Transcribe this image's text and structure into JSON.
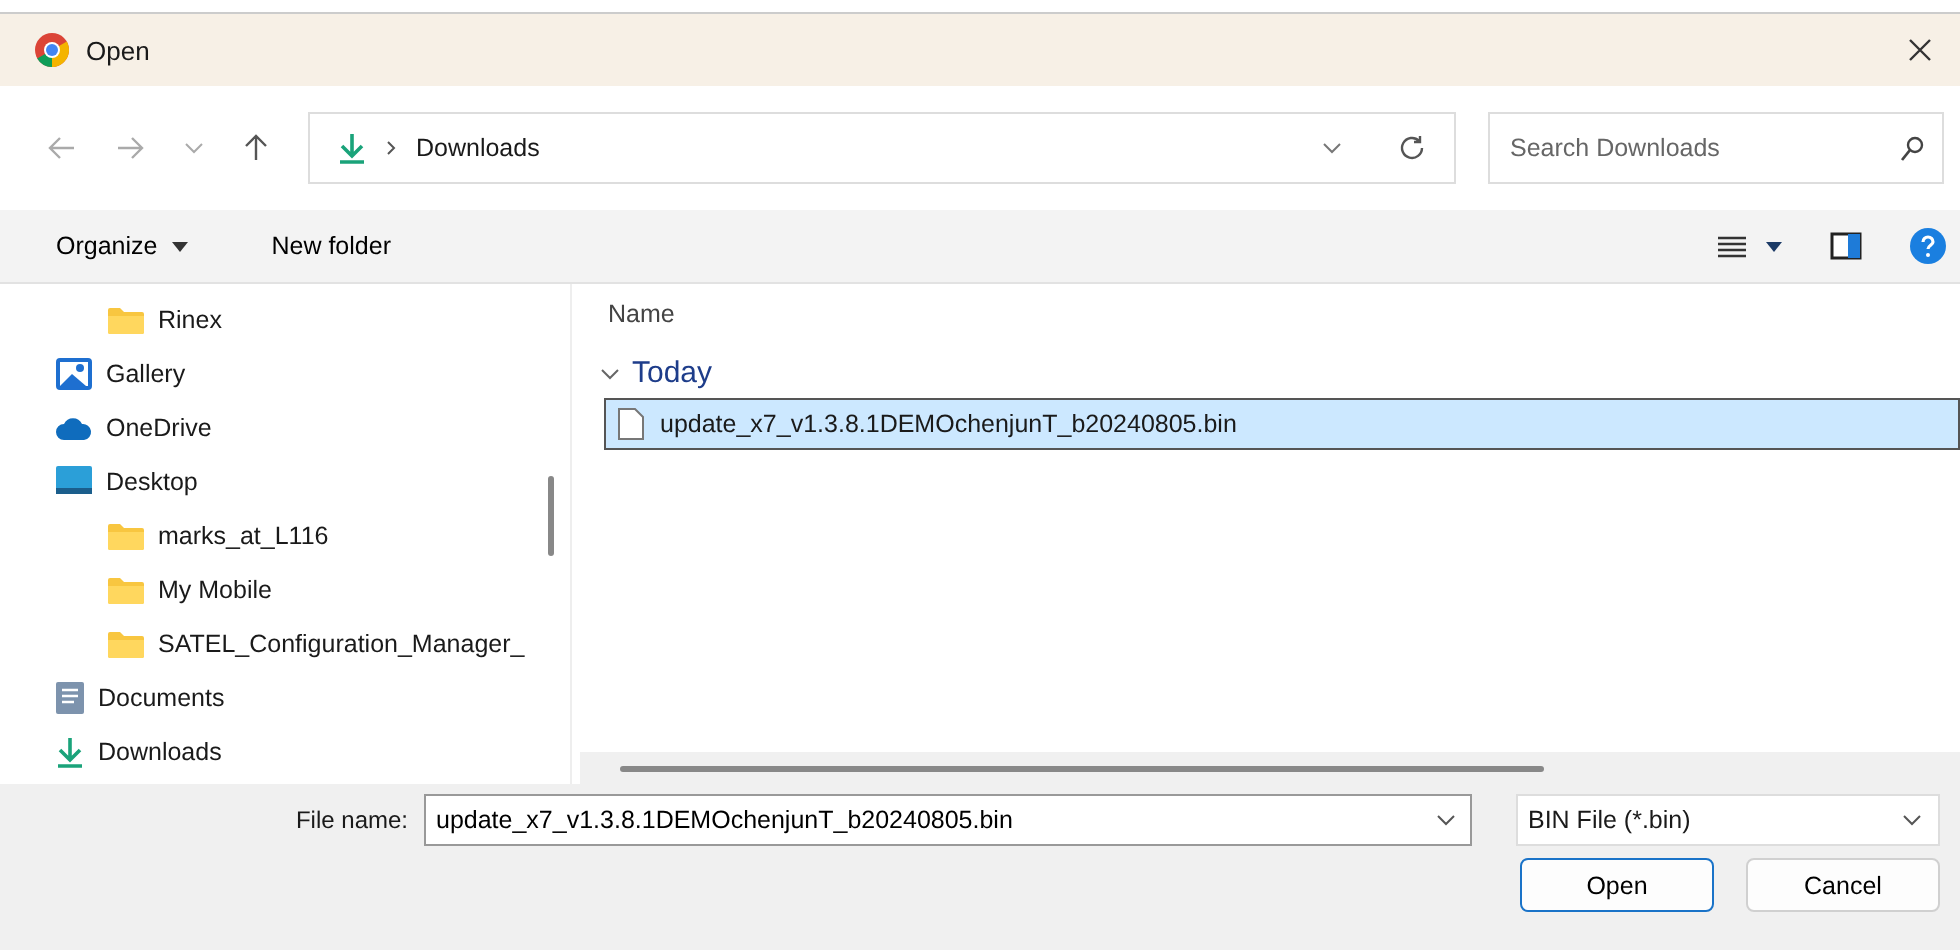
{
  "window": {
    "title": "Open"
  },
  "address": {
    "path": "Downloads",
    "search_placeholder": "Search Downloads"
  },
  "toolbar": {
    "organize": "Organize",
    "new_folder": "New folder"
  },
  "sidebar": {
    "items": [
      {
        "children": [
          {
            "label": "Rinex",
            "kind": "folder"
          }
        ]
      },
      {
        "label": "Gallery",
        "kind": "gallery"
      },
      {
        "label": "OneDrive",
        "kind": "cloud"
      },
      {
        "label": "Desktop",
        "kind": "desktop",
        "children": [
          {
            "label": "marks_at_L116",
            "kind": "folder"
          },
          {
            "label": "My Mobile",
            "kind": "folder"
          },
          {
            "label": "SATEL_Configuration_Manager_",
            "kind": "folder"
          }
        ]
      },
      {
        "label": "Documents",
        "kind": "documents"
      },
      {
        "label": "Downloads",
        "kind": "download"
      }
    ]
  },
  "file_list": {
    "columns": [
      "Name"
    ],
    "groups": [
      {
        "label": "Today",
        "expanded": true,
        "files": [
          {
            "name": "update_x7_v1.3.8.1DEMOchenjunT_b20240805.bin",
            "selected": true
          }
        ]
      }
    ]
  },
  "footer": {
    "file_name_label": "File name:",
    "file_name": "update_x7_v1.3.8.1DEMOchenjunT_b20240805.bin",
    "file_type": "BIN File (*.bin)",
    "buttons": [
      "Open",
      "Cancel"
    ]
  }
}
